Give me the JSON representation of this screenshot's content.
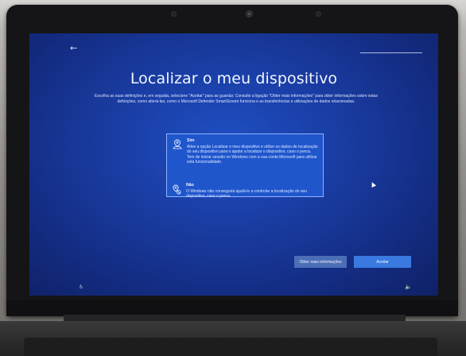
{
  "screen": {
    "back_icon": "back-arrow-icon",
    "title": "Localizar o meu dispositivo",
    "description_main": "Escolha as suas definições e, em seguida, selecione \"Aceitar\" para as guardar. Consulte a ligação \"Obter mais informações\" para obter informações sobre estas definições, como alterá-las, como o Microsoft Defender SmartScreen funciona e as transferências e utilizações de dados relacionadas.",
    "options": [
      {
        "title": "Sim",
        "description": "Ative a opção Localizar o meu dispositivo e utilize os dados de localização do seu dispositivo para o ajudar a localizar o dispositivo, caso o perca. Tem de iniciar sessão no Windows com a sua conta Microsoft para utilizar esta funcionalidade.",
        "icon": "device-location-icon",
        "selected": true
      },
      {
        "title": "Não",
        "description": "O Windows não conseguirá ajudá-lo a controlar a localização do seu dispositivo, caso o perca.",
        "icon": "device-location-off-icon",
        "selected": false
      }
    ],
    "buttons": {
      "more_info": "Obter mais informações",
      "accept": "Aceitar"
    },
    "bottom_left_icon": "ease-of-access-icon",
    "bottom_right_icon": "volume-icon",
    "colors": {
      "background": "#1a3ea6",
      "selected_option": "#1f56cc",
      "accept_button": "#3a7ae0",
      "more_info_button": "#4c6eb7"
    }
  }
}
